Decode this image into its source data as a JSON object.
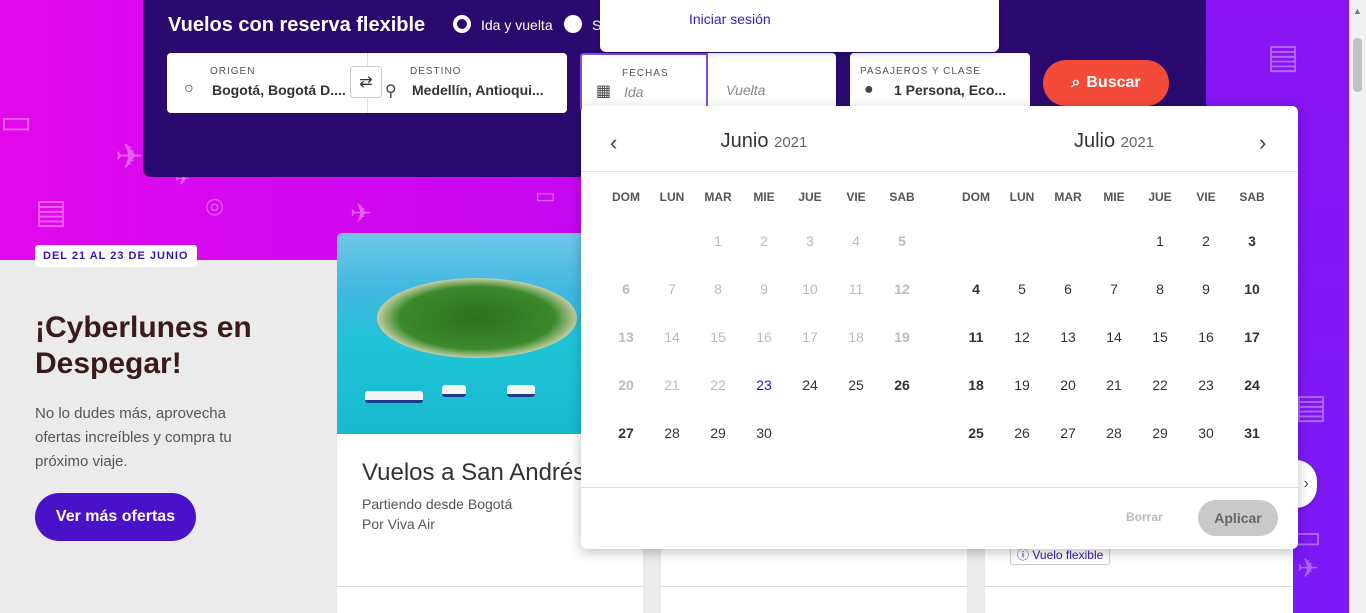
{
  "search": {
    "title": "Vuelos con reserva flexible",
    "trip_types": [
      "Ida y vuelta",
      "S"
    ],
    "origin": {
      "label": "ORIGEN",
      "value": "Bogotá, Bogotá D...."
    },
    "destination": {
      "label": "DESTINO",
      "value": "Medellín, Antioqui..."
    },
    "dates": {
      "label": "FECHAS",
      "departure_placeholder": "Ida",
      "return_placeholder": "Vuelta"
    },
    "passengers": {
      "label": "PASAJEROS Y CLASE",
      "value": "1 Persona, Eco..."
    },
    "search_button": "Buscar"
  },
  "login": {
    "link": "Iniciar sesión"
  },
  "promo": {
    "badge": "DEL 21 AL 23 DE JUNIO",
    "title": "¡Cyberlunes en Despegar!",
    "description": "No lo dudes más, aprovecha ofertas increíbles y compra tu próximo viaje.",
    "button": "Ver más ofertas"
  },
  "cards": [
    {
      "title": "Vuelos a San Andrés",
      "subtitle_1": "Partiendo desde Bogotá",
      "subtitle_2": "Por Viva Air"
    }
  ],
  "flex_badge": "Vuelo flexible",
  "calendar": {
    "weekdays": [
      "DOM",
      "LUN",
      "MAR",
      "MIE",
      "JUE",
      "VIE",
      "SAB"
    ],
    "months": [
      {
        "name": "Junio",
        "year": "2021"
      },
      {
        "name": "Julio",
        "year": "2021"
      }
    ],
    "clear_button": "Borrar",
    "apply_button": "Aplicar"
  },
  "colors": {
    "accent": "#f44a3a",
    "brand": "#2a0a6e",
    "primary": "#4a12c8"
  }
}
